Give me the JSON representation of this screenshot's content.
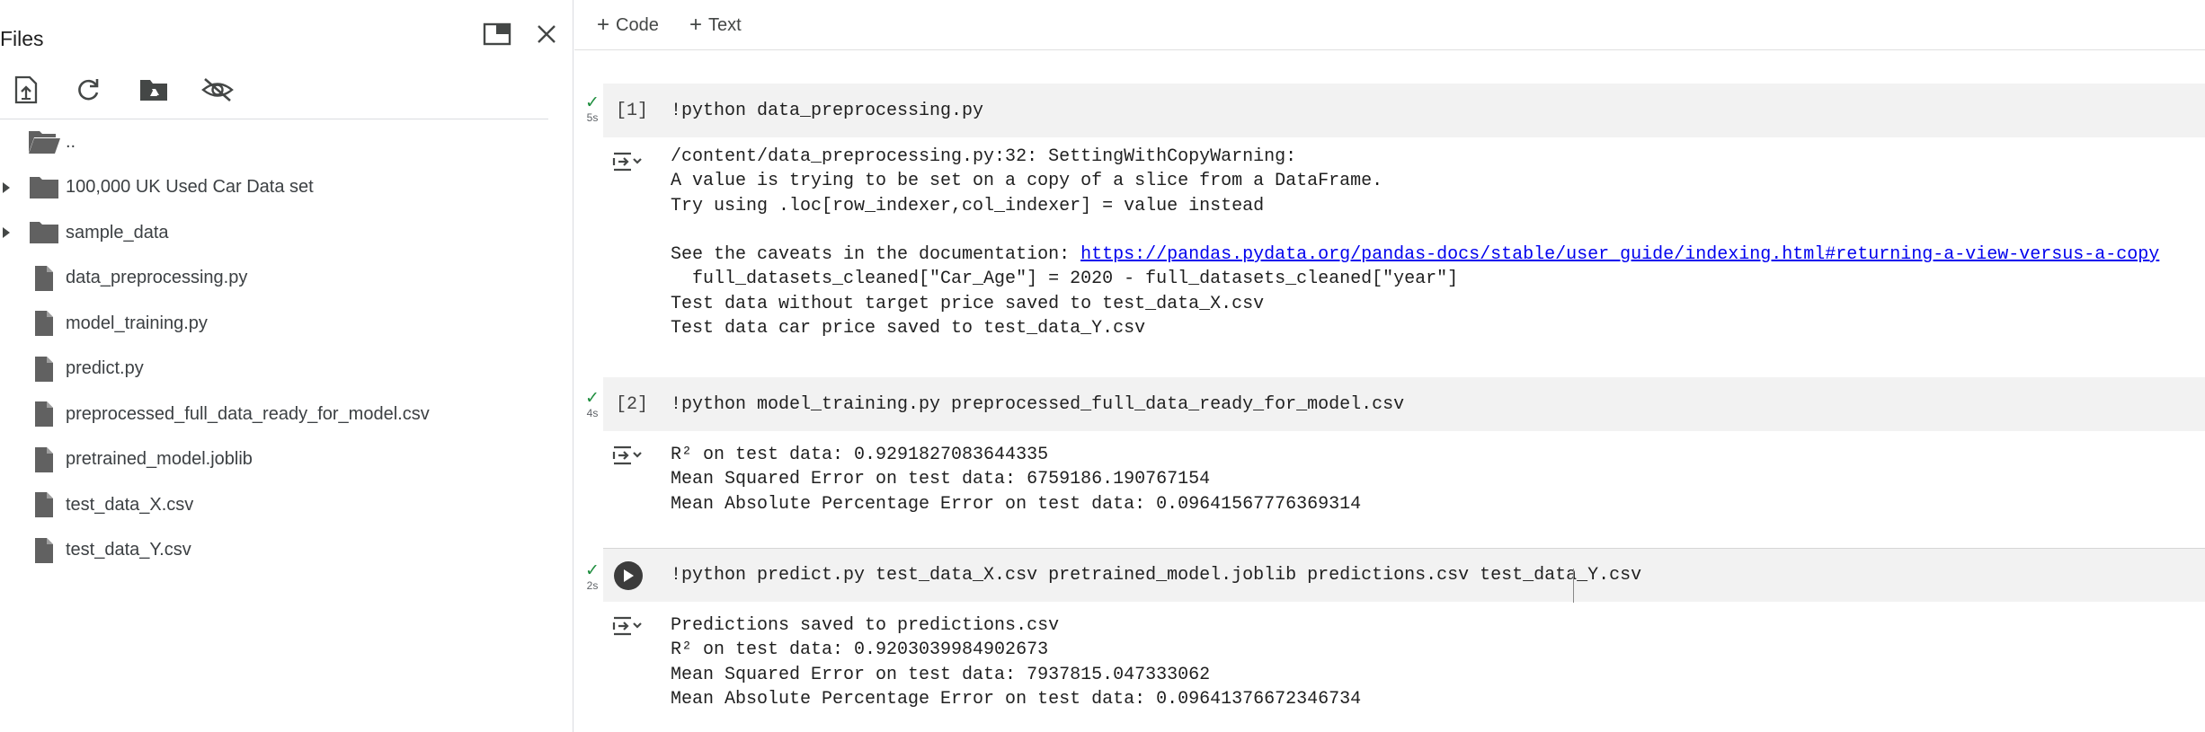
{
  "sidebar": {
    "title": "Files",
    "header_icons": [
      "open-in-new-tab-icon",
      "close-icon"
    ],
    "toolbar_icons": [
      "upload-file-icon",
      "refresh-icon",
      "mount-drive-icon",
      "hide-hidden-files-icon"
    ],
    "items": [
      {
        "label": "..",
        "type": "folder-open",
        "expandable": false
      },
      {
        "label": "100,000 UK Used Car Data set",
        "type": "folder",
        "expandable": true
      },
      {
        "label": "sample_data",
        "type": "folder",
        "expandable": true
      },
      {
        "label": "data_preprocessing.py",
        "type": "file",
        "expandable": false
      },
      {
        "label": "model_training.py",
        "type": "file",
        "expandable": false
      },
      {
        "label": "predict.py",
        "type": "file",
        "expandable": false
      },
      {
        "label": "preprocessed_full_data_ready_for_model.csv",
        "type": "file",
        "expandable": false
      },
      {
        "label": "pretrained_model.joblib",
        "type": "file",
        "expandable": false
      },
      {
        "label": "test_data_X.csv",
        "type": "file",
        "expandable": false
      },
      {
        "label": "test_data_Y.csv",
        "type": "file",
        "expandable": false
      }
    ]
  },
  "toolbar": {
    "add_code": "Code",
    "add_text": "Text"
  },
  "cells": [
    {
      "status": "✓",
      "duration": "5s",
      "exec_count": "[1]",
      "code": "!python data_preprocessing.py",
      "output": {
        "line1": "/content/data_preprocessing.py:32: SettingWithCopyWarning: ",
        "line2": "A value is trying to be set on a copy of a slice from a DataFrame.",
        "line3": "Try using .loc[row_indexer,col_indexer] = value instead",
        "line4": "",
        "line5_prefix": "See the caveats in the documentation: ",
        "line5_link": "https://pandas.pydata.org/pandas-docs/stable/user_guide/indexing.html#returning-a-view-versus-a-copy",
        "line6": "  full_datasets_cleaned[\"Car_Age\"] = 2020 - full_datasets_cleaned[\"year\"]",
        "line7": "Test data without target price saved to test_data_X.csv",
        "line8": "Test data car price saved to test_data_Y.csv"
      }
    },
    {
      "status": "✓",
      "duration": "4s",
      "exec_count": "[2]",
      "code": "!python model_training.py preprocessed_full_data_ready_for_model.csv",
      "output": {
        "line1": "R² on test data: 0.9291827083644335",
        "line2": "Mean Squared Error on test data: 6759186.190767154",
        "line3": "Mean Absolute Percentage Error on test data: 0.09641567776369314"
      }
    },
    {
      "status": "✓",
      "duration": "2s",
      "exec_count": "",
      "code": "!python predict.py test_data_X.csv pretrained_model.joblib predictions.csv test_data_Y.csv",
      "output": {
        "line1": "Predictions saved to predictions.csv",
        "line2": "R² on test data: 0.9203039984902673",
        "line3": "Mean Squared Error on test data: 7937815.047333062",
        "line4": "Mean Absolute Percentage Error on test data: 0.09641376672346734"
      }
    }
  ],
  "colors": {
    "success": "#1e8e3e",
    "code_bg": "#f2f2f2",
    "link": "#0000ee"
  }
}
